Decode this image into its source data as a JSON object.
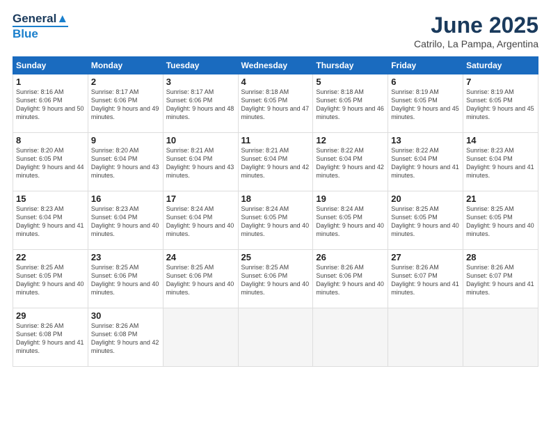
{
  "header": {
    "logo_line1": "General",
    "logo_line2": "Blue",
    "title": "June 2025",
    "subtitle": "Catrilo, La Pampa, Argentina"
  },
  "weekdays": [
    "Sunday",
    "Monday",
    "Tuesday",
    "Wednesday",
    "Thursday",
    "Friday",
    "Saturday"
  ],
  "weeks": [
    [
      {
        "day": "1",
        "sunrise": "Sunrise: 8:16 AM",
        "sunset": "Sunset: 6:06 PM",
        "daylight": "Daylight: 9 hours and 50 minutes."
      },
      {
        "day": "2",
        "sunrise": "Sunrise: 8:17 AM",
        "sunset": "Sunset: 6:06 PM",
        "daylight": "Daylight: 9 hours and 49 minutes."
      },
      {
        "day": "3",
        "sunrise": "Sunrise: 8:17 AM",
        "sunset": "Sunset: 6:06 PM",
        "daylight": "Daylight: 9 hours and 48 minutes."
      },
      {
        "day": "4",
        "sunrise": "Sunrise: 8:18 AM",
        "sunset": "Sunset: 6:05 PM",
        "daylight": "Daylight: 9 hours and 47 minutes."
      },
      {
        "day": "5",
        "sunrise": "Sunrise: 8:18 AM",
        "sunset": "Sunset: 6:05 PM",
        "daylight": "Daylight: 9 hours and 46 minutes."
      },
      {
        "day": "6",
        "sunrise": "Sunrise: 8:19 AM",
        "sunset": "Sunset: 6:05 PM",
        "daylight": "Daylight: 9 hours and 45 minutes."
      },
      {
        "day": "7",
        "sunrise": "Sunrise: 8:19 AM",
        "sunset": "Sunset: 6:05 PM",
        "daylight": "Daylight: 9 hours and 45 minutes."
      }
    ],
    [
      {
        "day": "8",
        "sunrise": "Sunrise: 8:20 AM",
        "sunset": "Sunset: 6:05 PM",
        "daylight": "Daylight: 9 hours and 44 minutes."
      },
      {
        "day": "9",
        "sunrise": "Sunrise: 8:20 AM",
        "sunset": "Sunset: 6:04 PM",
        "daylight": "Daylight: 9 hours and 43 minutes."
      },
      {
        "day": "10",
        "sunrise": "Sunrise: 8:21 AM",
        "sunset": "Sunset: 6:04 PM",
        "daylight": "Daylight: 9 hours and 43 minutes."
      },
      {
        "day": "11",
        "sunrise": "Sunrise: 8:21 AM",
        "sunset": "Sunset: 6:04 PM",
        "daylight": "Daylight: 9 hours and 42 minutes."
      },
      {
        "day": "12",
        "sunrise": "Sunrise: 8:22 AM",
        "sunset": "Sunset: 6:04 PM",
        "daylight": "Daylight: 9 hours and 42 minutes."
      },
      {
        "day": "13",
        "sunrise": "Sunrise: 8:22 AM",
        "sunset": "Sunset: 6:04 PM",
        "daylight": "Daylight: 9 hours and 41 minutes."
      },
      {
        "day": "14",
        "sunrise": "Sunrise: 8:23 AM",
        "sunset": "Sunset: 6:04 PM",
        "daylight": "Daylight: 9 hours and 41 minutes."
      }
    ],
    [
      {
        "day": "15",
        "sunrise": "Sunrise: 8:23 AM",
        "sunset": "Sunset: 6:04 PM",
        "daylight": "Daylight: 9 hours and 41 minutes."
      },
      {
        "day": "16",
        "sunrise": "Sunrise: 8:23 AM",
        "sunset": "Sunset: 6:04 PM",
        "daylight": "Daylight: 9 hours and 40 minutes."
      },
      {
        "day": "17",
        "sunrise": "Sunrise: 8:24 AM",
        "sunset": "Sunset: 6:04 PM",
        "daylight": "Daylight: 9 hours and 40 minutes."
      },
      {
        "day": "18",
        "sunrise": "Sunrise: 8:24 AM",
        "sunset": "Sunset: 6:05 PM",
        "daylight": "Daylight: 9 hours and 40 minutes."
      },
      {
        "day": "19",
        "sunrise": "Sunrise: 8:24 AM",
        "sunset": "Sunset: 6:05 PM",
        "daylight": "Daylight: 9 hours and 40 minutes."
      },
      {
        "day": "20",
        "sunrise": "Sunrise: 8:25 AM",
        "sunset": "Sunset: 6:05 PM",
        "daylight": "Daylight: 9 hours and 40 minutes."
      },
      {
        "day": "21",
        "sunrise": "Sunrise: 8:25 AM",
        "sunset": "Sunset: 6:05 PM",
        "daylight": "Daylight: 9 hours and 40 minutes."
      }
    ],
    [
      {
        "day": "22",
        "sunrise": "Sunrise: 8:25 AM",
        "sunset": "Sunset: 6:05 PM",
        "daylight": "Daylight: 9 hours and 40 minutes."
      },
      {
        "day": "23",
        "sunrise": "Sunrise: 8:25 AM",
        "sunset": "Sunset: 6:06 PM",
        "daylight": "Daylight: 9 hours and 40 minutes."
      },
      {
        "day": "24",
        "sunrise": "Sunrise: 8:25 AM",
        "sunset": "Sunset: 6:06 PM",
        "daylight": "Daylight: 9 hours and 40 minutes."
      },
      {
        "day": "25",
        "sunrise": "Sunrise: 8:25 AM",
        "sunset": "Sunset: 6:06 PM",
        "daylight": "Daylight: 9 hours and 40 minutes."
      },
      {
        "day": "26",
        "sunrise": "Sunrise: 8:26 AM",
        "sunset": "Sunset: 6:06 PM",
        "daylight": "Daylight: 9 hours and 40 minutes."
      },
      {
        "day": "27",
        "sunrise": "Sunrise: 8:26 AM",
        "sunset": "Sunset: 6:07 PM",
        "daylight": "Daylight: 9 hours and 41 minutes."
      },
      {
        "day": "28",
        "sunrise": "Sunrise: 8:26 AM",
        "sunset": "Sunset: 6:07 PM",
        "daylight": "Daylight: 9 hours and 41 minutes."
      }
    ],
    [
      {
        "day": "29",
        "sunrise": "Sunrise: 8:26 AM",
        "sunset": "Sunset: 6:08 PM",
        "daylight": "Daylight: 9 hours and 41 minutes."
      },
      {
        "day": "30",
        "sunrise": "Sunrise: 8:26 AM",
        "sunset": "Sunset: 6:08 PM",
        "daylight": "Daylight: 9 hours and 42 minutes."
      },
      null,
      null,
      null,
      null,
      null
    ]
  ]
}
